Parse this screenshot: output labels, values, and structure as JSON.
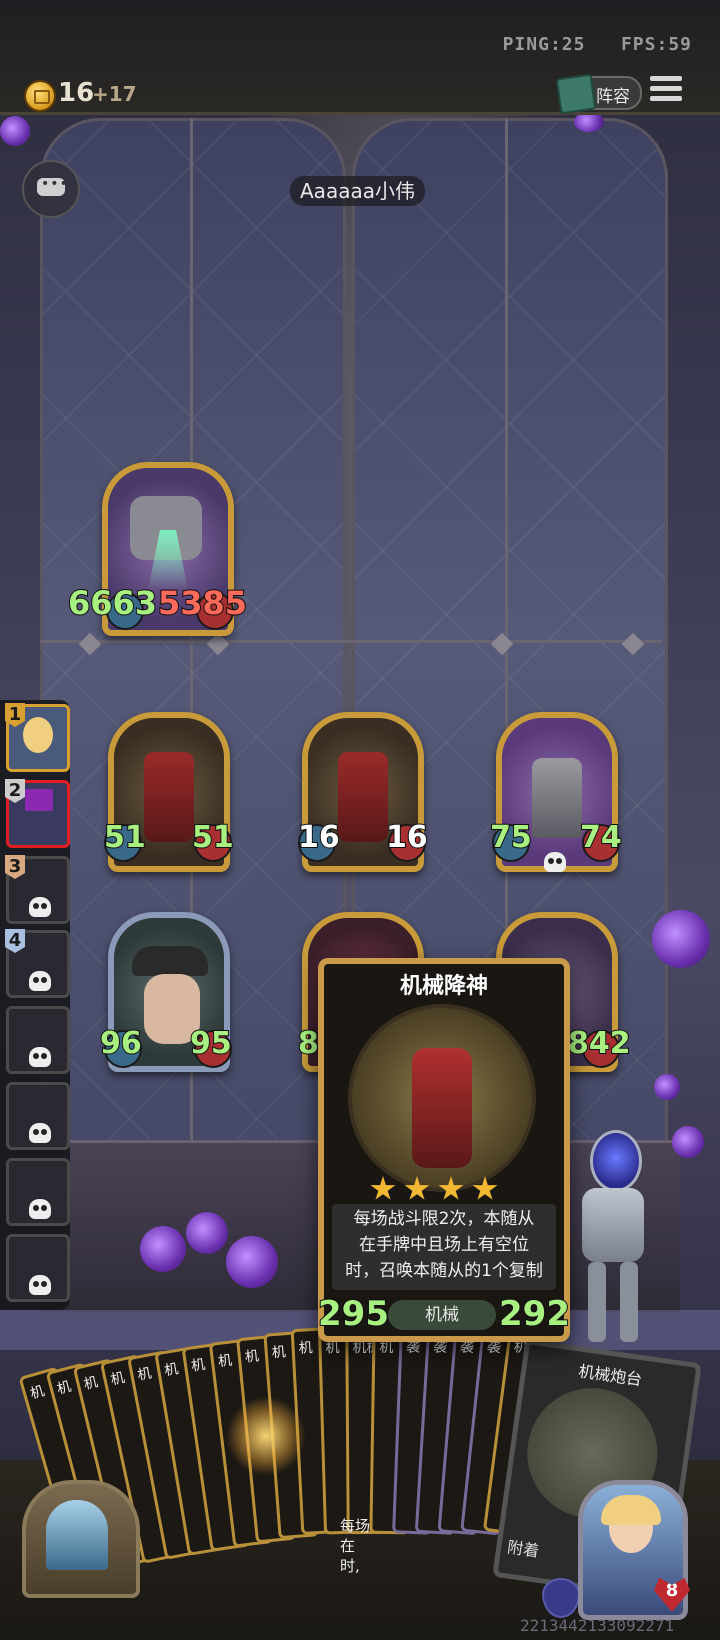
{
  "topbar": {
    "ping": "PING:25",
    "fps": "FPS:59",
    "gold": "16",
    "gold_income": "+17",
    "lineup_label": "阵容"
  },
  "opponent": {
    "name": "Aaaaaa小伟"
  },
  "enemy_board": [
    {
      "attack": "6663",
      "health": "5385",
      "icon": "mech-dragon-portrait"
    }
  ],
  "player_board": {
    "row1": [
      {
        "attack": "51",
        "health": "51",
        "icon": "mech-god-portrait",
        "atk_color": "#a8f080",
        "hp_color": "#a8f080"
      },
      {
        "attack": "16",
        "health": "16",
        "icon": "mech-god-portrait",
        "atk_color": "#ffffff",
        "hp_color": "#ffffff"
      },
      {
        "attack": "75",
        "health": "74",
        "icon": "robot-trashcan-portrait",
        "atk_color": "#a8f080",
        "hp_color": "#a8f080"
      }
    ],
    "row2": [
      {
        "attack": "96",
        "health": "95",
        "icon": "old-wizard-portrait"
      },
      {
        "attack": "8",
        "health": "",
        "icon": "hidden-minion-portrait"
      },
      {
        "attack": "",
        "health": "842",
        "icon": "castle-minion-portrait"
      }
    ]
  },
  "player_ranking": [
    {
      "rank": "1",
      "icon": "blonde-girl-avatar"
    },
    {
      "rank": "2",
      "icon": "top-hat-avatar"
    },
    {
      "rank": "3",
      "icon": "dead-player-avatar"
    },
    {
      "rank": "4",
      "icon": "dead-player-avatar"
    },
    {
      "rank": "",
      "icon": "dead-player-avatar"
    },
    {
      "rank": "",
      "icon": "dead-player-avatar"
    },
    {
      "rank": "",
      "icon": "dead-player-avatar"
    },
    {
      "rank": "",
      "icon": "dead-player-avatar"
    }
  ],
  "card_tooltip": {
    "title": "机械降神",
    "description_line1": "每场战斗限2次，本随从",
    "description_line2": "在手牌中且场上有空位",
    "description_line3": "时，召唤本随从的1个复制",
    "tribe": "机械",
    "attack": "295",
    "health": "292",
    "stars": 4
  },
  "hand": {
    "cards": [
      "机",
      "机",
      "机",
      "机",
      "机",
      "机",
      "机",
      "机",
      "机",
      "机",
      "机",
      "机",
      "机械",
      "机",
      "袭",
      "袭",
      "袭",
      "袭",
      "机"
    ],
    "big_card_title": "机械炮台",
    "big_card_attach": "附着",
    "small_text_1": "每场",
    "small_text_2": "在",
    "small_text_3": "时,"
  },
  "hero": {
    "health": "8",
    "id_text": "2213442133092271"
  }
}
